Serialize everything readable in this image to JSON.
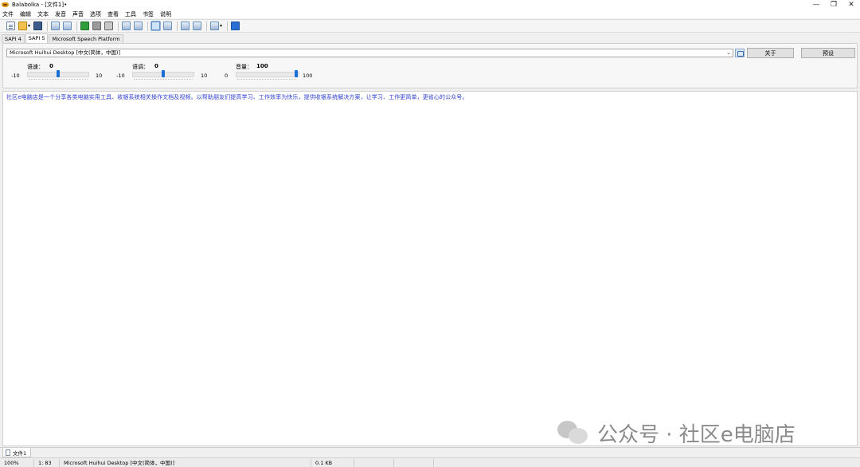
{
  "window": {
    "title": "Balabolka - [文件1]•",
    "minimize_glyph": "—",
    "maximize_glyph": "❐",
    "close_glyph": "✕"
  },
  "menu": [
    "文件",
    "编辑",
    "文本",
    "发音",
    "声音",
    "选项",
    "查看",
    "工具",
    "书签",
    "说明"
  ],
  "engine_tabs": [
    "SAPI 4",
    "SAPI 5",
    "Microsoft Speech Platform"
  ],
  "voice": {
    "selected": "Microsoft Huihui Desktop [中文(简体，中国)]",
    "about_label": "关于",
    "preset_label": "预设"
  },
  "sliders": {
    "rate": {
      "label": "语速：",
      "value": 0,
      "min": -10,
      "max": 10
    },
    "pitch": {
      "label": "语调：",
      "value": 0,
      "min": -10,
      "max": 10
    },
    "volume": {
      "label": "音量：",
      "value": 100,
      "min": 0,
      "max": 100
    }
  },
  "editor": {
    "text": "社区e电脑店是一个分享各类电脑实用工具、收银系统相关操作文档及视频。以帮助朋友们提高学习、工作效率为快乐，提供收银系统解决方案，让学习、工作更简单，更省心的公众号。"
  },
  "watermark": {
    "text": "公众号 · 社区e电脑店",
    "icon": "wechat-icon"
  },
  "doc_tabs": [
    "文件1"
  ],
  "status": {
    "zoom": "100%",
    "position": "1:   83",
    "voice": "Microsoft Huihui Desktop [中文(简体，中国)]",
    "size": "0.1 KB"
  }
}
